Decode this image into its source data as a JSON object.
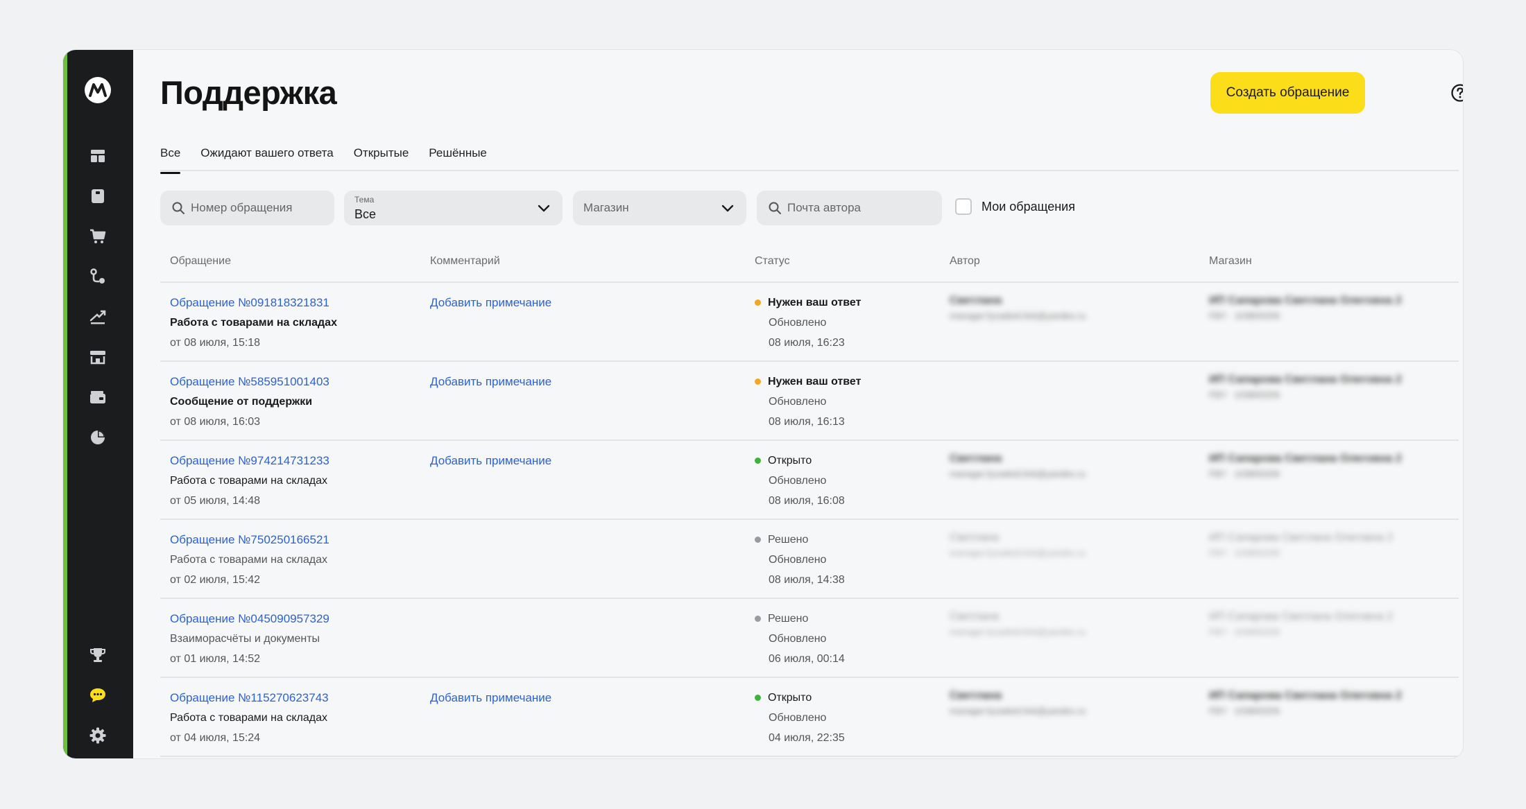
{
  "header": {
    "title": "Поддержка",
    "create_button": "Создать обращение"
  },
  "sidebar": {
    "icons": [
      "market-logo-icon",
      "dashboard-icon",
      "product-card-icon",
      "cart-icon",
      "logistics-icon",
      "growth-icon",
      "storefront-icon",
      "wallet-icon",
      "pie-chart-icon",
      "trophy-icon",
      "chat-icon",
      "settings-icon"
    ]
  },
  "tabs": [
    "Все",
    "Ожидают вашего ответа",
    "Открытые",
    "Решённые"
  ],
  "filters": {
    "ticket_number_placeholder": "Номер обращения",
    "topic_label": "Тема",
    "topic_value": "Все",
    "shop_placeholder": "Магазин",
    "author_email_placeholder": "Почта автора",
    "my_tickets_label": "Мои обращения"
  },
  "columns": [
    "Обращение",
    "Комментарий",
    "Статус",
    "Автор",
    "Магазин"
  ],
  "colors": {
    "accent_yellow": "#fcdd1a",
    "link_blue": "#2a62d9",
    "status_orange": "#f5a623",
    "status_green": "#3cb43c",
    "status_gray": "#9a9aa0"
  },
  "rows": [
    {
      "ticket": "Обращение №091818321831",
      "topic": "Работа с товарами на складах",
      "created": "от 08 июля, 15:18",
      "comment": "Добавить примечание",
      "status": "Нужен ваш ответ",
      "updated_label": "Обновлено",
      "updated": "08 июля, 16:23",
      "author_name": "Светлана",
      "author_email": "manager.fyzadeid.link@yandex.ru",
      "shop_name": "ИП Сапарова Светлана Олеговна 2",
      "shop_id": "FBY · 103800209"
    },
    {
      "ticket": "Обращение №585951001403",
      "topic": "Сообщение от поддержки",
      "created": "от 08 июля, 16:03",
      "comment": "Добавить примечание",
      "status": "Нужен ваш ответ",
      "updated_label": "Обновлено",
      "updated": "08 июля, 16:13",
      "author_name": "",
      "author_email": "",
      "shop_name": "ИП Сапарова Светлана Олеговна 2",
      "shop_id": "FBY · 103800209"
    },
    {
      "ticket": "Обращение №974214731233",
      "topic": "Работа с товарами на складах",
      "created": "от 05 июля, 14:48",
      "comment": "Добавить примечание",
      "status": "Открыто",
      "updated_label": "Обновлено",
      "updated": "08 июля, 16:08",
      "author_name": "Светлана",
      "author_email": "manager.fyzadeid.link@yandex.ru",
      "shop_name": "ИП Сапарова Светлана Олеговна 2",
      "shop_id": "FBY · 103800209"
    },
    {
      "ticket": "Обращение №750250166521",
      "topic": "Работа с товарами на складах",
      "created": "от 02 июля, 15:42",
      "comment": "",
      "status": "Решено",
      "updated_label": "Обновлено",
      "updated": "08 июля, 14:38",
      "author_name": "Светлана",
      "author_email": "manager.fyzadeid.link@yandex.ru",
      "shop_name": "ИП Сапарова Светлана Олеговна 2",
      "shop_id": "FBY · 103800209"
    },
    {
      "ticket": "Обращение №045090957329",
      "topic": "Взаиморасчёты и документы",
      "created": "от 01 июля, 14:52",
      "comment": "",
      "status": "Решено",
      "updated_label": "Обновлено",
      "updated": "06 июля, 00:14",
      "author_name": "Светлана",
      "author_email": "manager.fyzadeid.link@yandex.ru",
      "shop_name": "ИП Сапарова Светлана Олеговна 2",
      "shop_id": "FBY · 103800209"
    },
    {
      "ticket": "Обращение №115270623743",
      "topic": "Работа с товарами на складах",
      "created": "от 04 июля, 15:24",
      "comment": "Добавить примечание",
      "status": "Открыто",
      "updated_label": "Обновлено",
      "updated": "04 июля, 22:35",
      "author_name": "Светлана",
      "author_email": "manager.fyzadeid.link@yandex.ru",
      "shop_name": "ИП Сапарова Светлана Олеговна 2",
      "shop_id": "FBY · 103800209"
    }
  ]
}
